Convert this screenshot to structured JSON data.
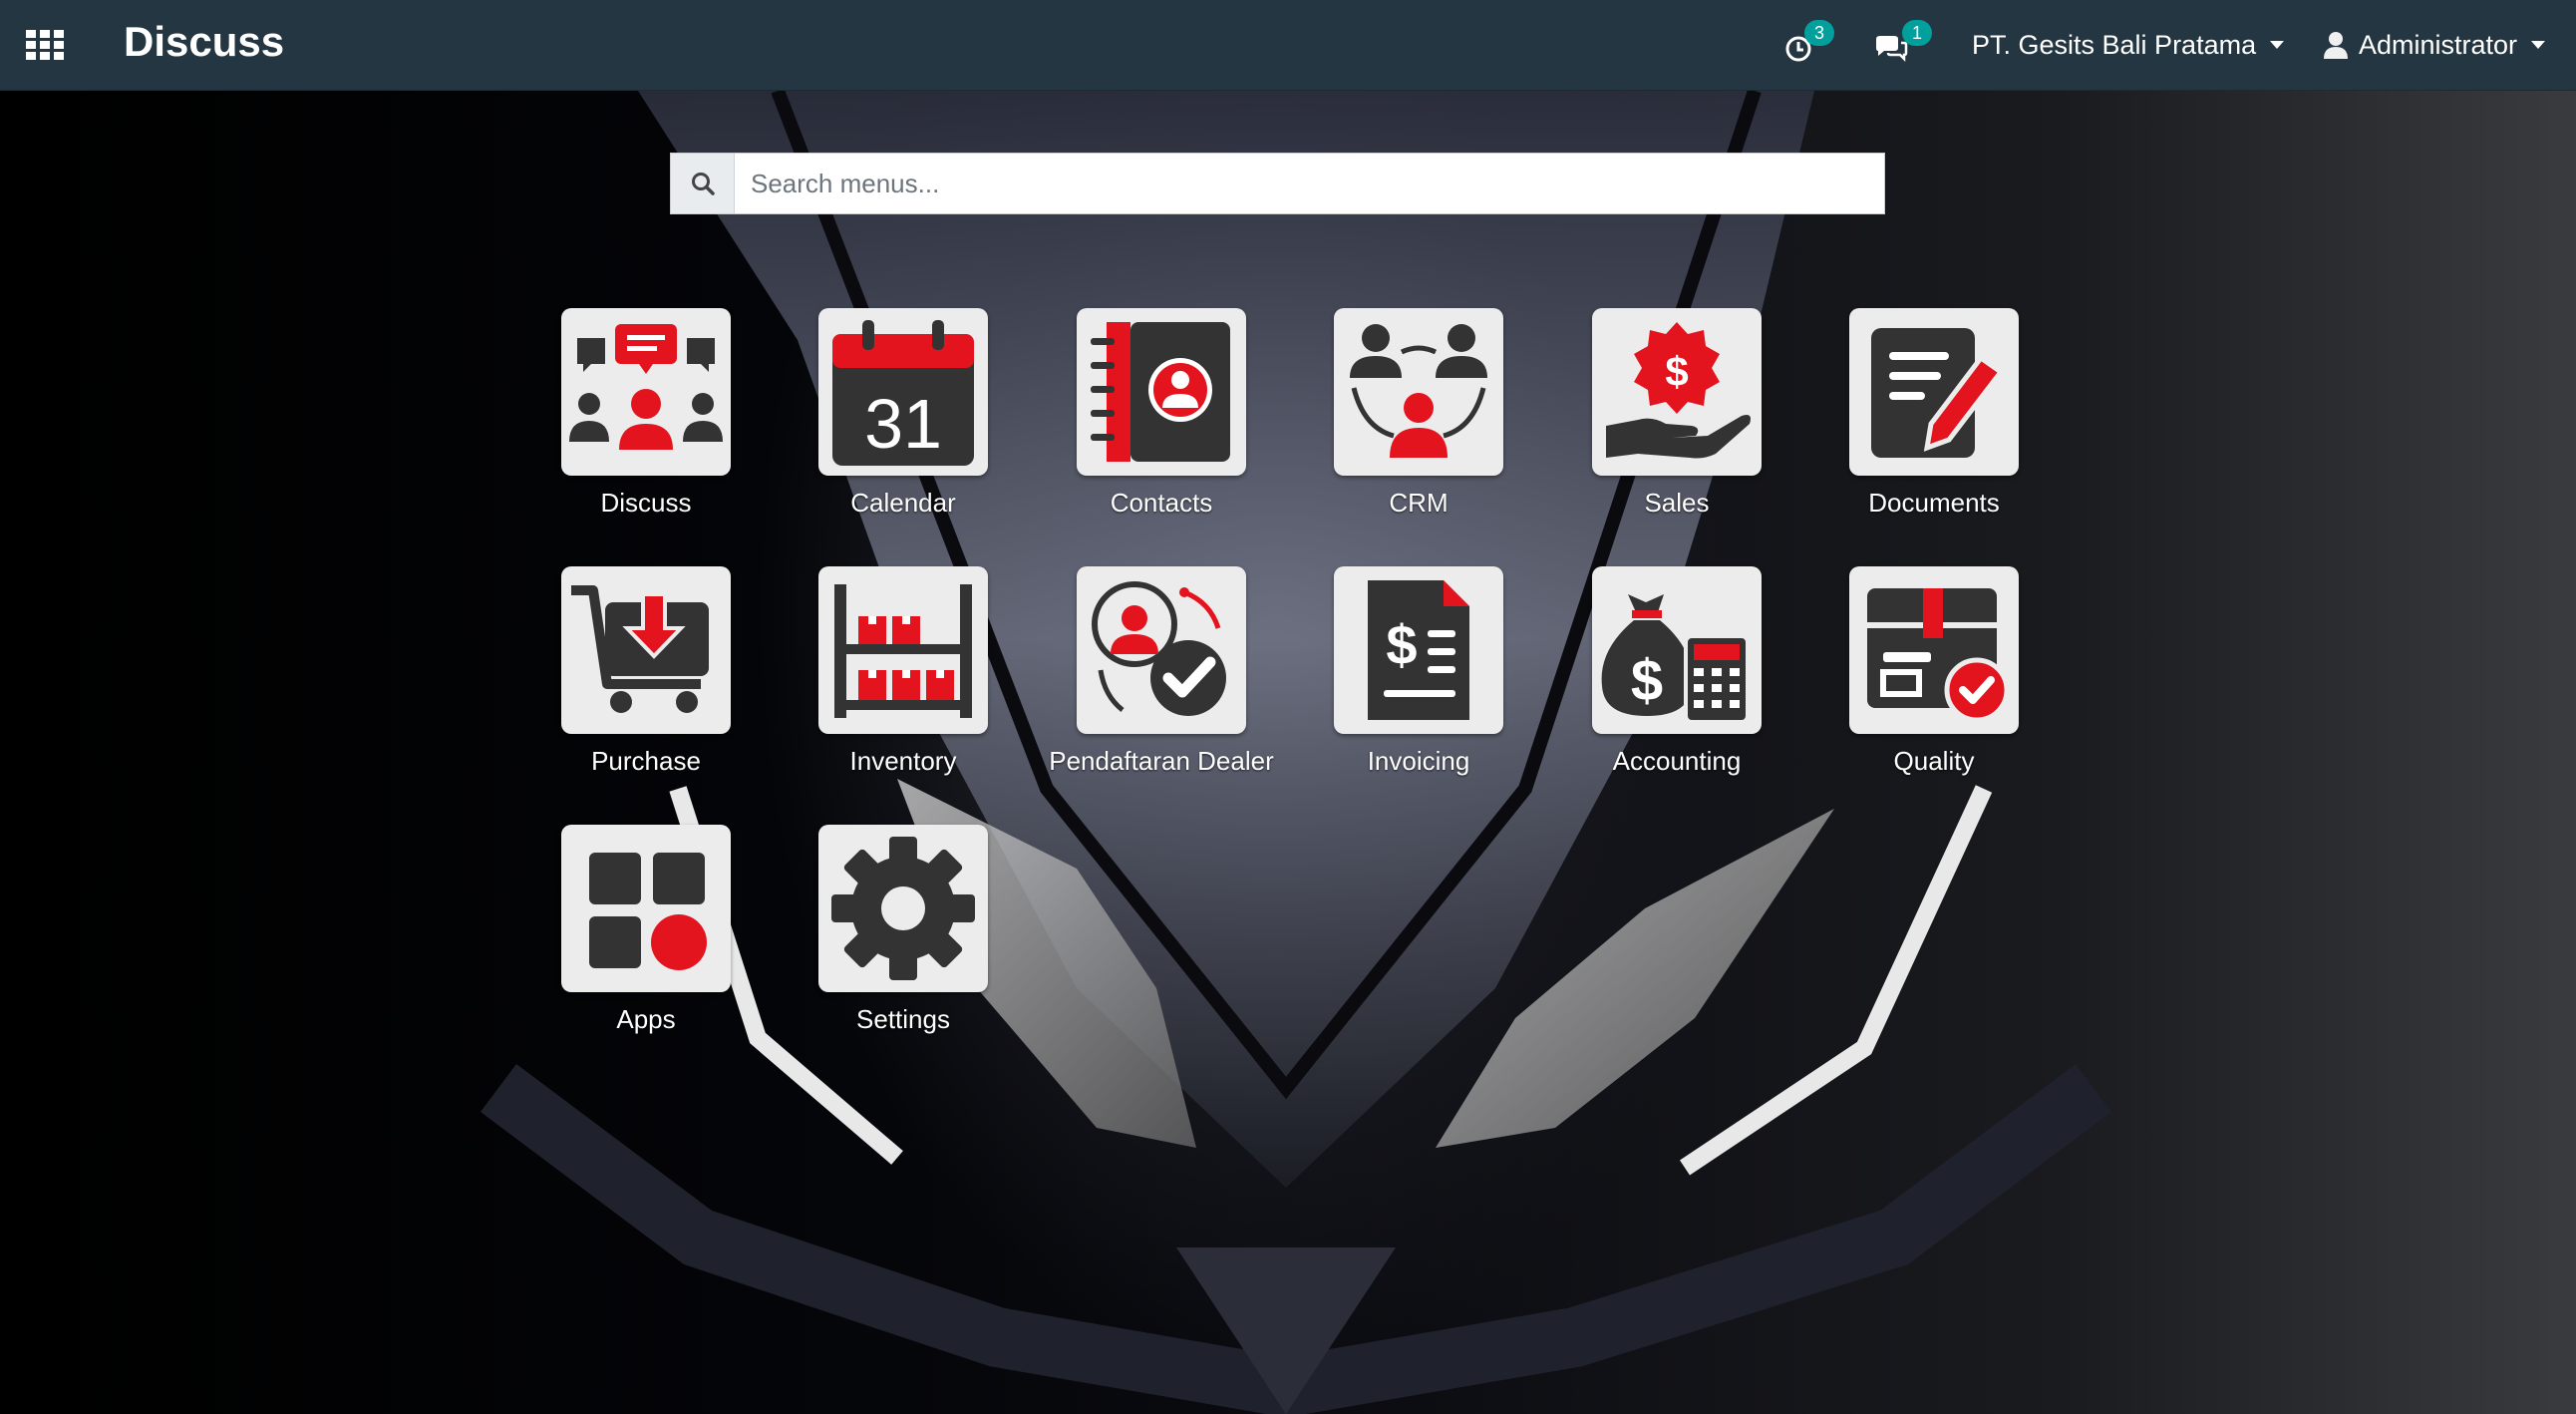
{
  "topbar": {
    "app_title": "Discuss",
    "activity_count": "3",
    "messages_count": "1",
    "company": "PT. Gesits Bali Pratama",
    "user": "Administrator"
  },
  "search": {
    "placeholder": "Search menus..."
  },
  "colors": {
    "topbar": "#243642",
    "accent_red": "#e3141e",
    "icon_dark": "#333333",
    "icon_bg": "#ececec",
    "badge": "#01a09d"
  },
  "apps": [
    {
      "label": "Discuss",
      "icon": "discuss-icon"
    },
    {
      "label": "Calendar",
      "icon": "calendar-icon",
      "day": "31"
    },
    {
      "label": "Contacts",
      "icon": "contacts-icon"
    },
    {
      "label": "CRM",
      "icon": "crm-icon"
    },
    {
      "label": "Sales",
      "icon": "sales-icon"
    },
    {
      "label": "Documents",
      "icon": "documents-icon"
    },
    {
      "label": "Purchase",
      "icon": "purchase-icon"
    },
    {
      "label": "Inventory",
      "icon": "inventory-icon"
    },
    {
      "label": "Pendaftaran Dealer",
      "icon": "dealer-registration-icon"
    },
    {
      "label": "Invoicing",
      "icon": "invoicing-icon"
    },
    {
      "label": "Accounting",
      "icon": "accounting-icon"
    },
    {
      "label": "Quality",
      "icon": "quality-icon"
    },
    {
      "label": "Apps",
      "icon": "apps-icon"
    },
    {
      "label": "Settings",
      "icon": "settings-icon"
    }
  ]
}
